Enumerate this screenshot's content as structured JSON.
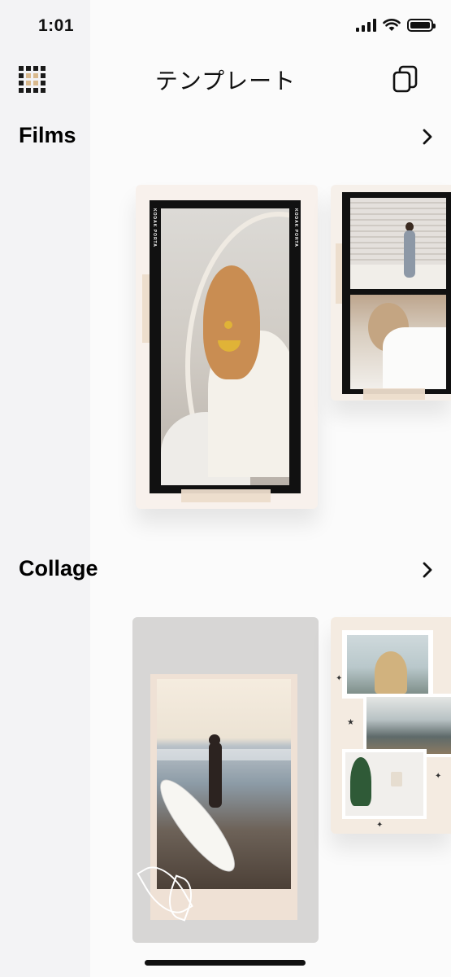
{
  "status_bar": {
    "time": "1:01",
    "icons": [
      "signal-icon",
      "wifi-icon",
      "battery-icon"
    ]
  },
  "header": {
    "title": "テンプレート",
    "left_icon": "grid-icon",
    "right_icon": "copy-icon"
  },
  "sections": [
    {
      "title": "Films",
      "chevron": "chevron-right-icon",
      "film_strip_text": "KODAK PORTA"
    },
    {
      "title": "Collage",
      "chevron": "chevron-right-icon"
    }
  ],
  "colors": {
    "accent_tan": "#d9b98d",
    "film_black": "#111111",
    "card_cream": "#f8f1ec"
  }
}
